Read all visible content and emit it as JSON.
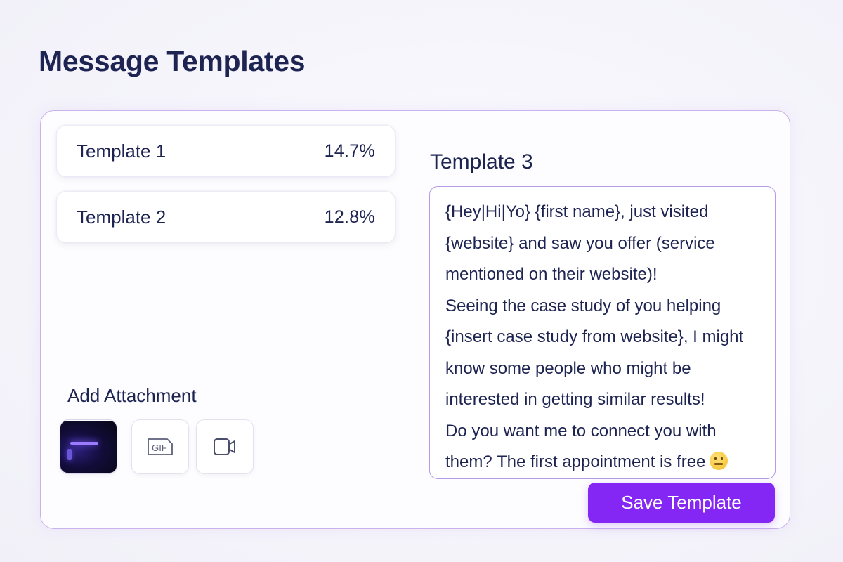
{
  "page": {
    "title": "Message Templates"
  },
  "templates": [
    {
      "name": "Template 1",
      "rate": "14.7%"
    },
    {
      "name": "Template 2",
      "rate": "12.8%"
    }
  ],
  "attachments": {
    "label": "Add Attachment",
    "buttons": [
      {
        "type": "image-thumbnail"
      },
      {
        "type": "gif",
        "icon_text": "GIF"
      },
      {
        "type": "video",
        "icon": "video-camera-icon"
      }
    ]
  },
  "editor": {
    "title": "Template 3",
    "lines": [
      "{Hey|Hi|Yo} {first name}, just visited",
      "{website} and saw you offer (service",
      "mentioned on their website)!",
      "Seeing the case study of you helping",
      "{insert case study from website}, I might",
      "know some people who might be",
      "interested in getting similar results!",
      "Do you want me to connect you with",
      "them? The first appointment is free"
    ],
    "emoji": "grimacing-face-emoji"
  },
  "save_button": {
    "label": "Save Template"
  },
  "colors": {
    "accent": "#8427f5",
    "border": "#c9b2ee",
    "text": "#1e2452"
  }
}
